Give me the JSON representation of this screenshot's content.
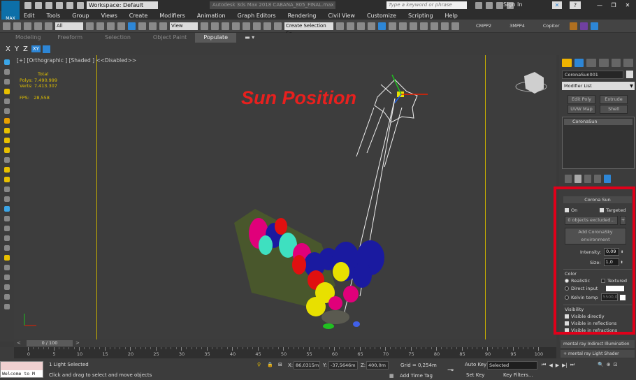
{
  "title_bar": {
    "app_badge": "MAX",
    "workspace": "Workspace: Default",
    "window_title": "Autodesk 3ds Max 2018    CABANA_805_FINAL.max",
    "search_placeholder": "Type a keyword or phrase",
    "sign_in": "Sign In"
  },
  "menu": [
    "Edit",
    "Tools",
    "Group",
    "Views",
    "Create",
    "Modifiers",
    "Animation",
    "Graph Editors",
    "Rendering",
    "Civil View",
    "Customize",
    "Scripting",
    "Help"
  ],
  "toolbar": {
    "filter_all": "All",
    "ref_coord": "View",
    "selection_set": "Create Selection Se",
    "extra": [
      "CMPP2",
      "3MPP4",
      "Copitor"
    ]
  },
  "ribbon_tabs": [
    "Modeling",
    "Freeform",
    "Selection",
    "Object Paint",
    "Populate"
  ],
  "ribbon_active": "Populate",
  "axes": [
    "X",
    "Y",
    "Z",
    "XY"
  ],
  "viewport": {
    "label": "[+] [Orthographic ] [Shaded ]  <<Disabled>>",
    "stats_total": "Total",
    "stats_polys_label": "Polys:",
    "stats_polys": "7.490.999",
    "stats_verts_label": "Verts:",
    "stats_verts": "7.413.307",
    "stats_fps_label": "FPS:",
    "stats_fps": "28,558",
    "annotation": "Sun Position"
  },
  "command_panel": {
    "object_name": "CoronaSun001",
    "modifier_list": "Modifier List",
    "buttons": [
      "Edit Poly",
      "Extrude",
      "UVW Map",
      "Shell"
    ],
    "stack_item": "CoronaSun",
    "rollout_title": "Corona Sun",
    "on_label": "On",
    "targeted_label": "Targeted",
    "excluded_button": "0 objects excluded...",
    "plus_button": "+",
    "add_sky_button": "Add CoronaSky environment",
    "intensity_label": "Intensity:",
    "intensity_value": "0,09",
    "size_label": "Size:",
    "size_value": "1,0",
    "color_label": "Color",
    "color_realistic": "Realistic",
    "color_textured": "Textured",
    "color_direct": "Direct input",
    "color_kelvin": "Kelvin temp",
    "kelvin_value": "5500,0",
    "visibility_label": "Visibility",
    "vis_directly": "Visible directly",
    "vis_reflections": "Visible in reflections",
    "vis_refractions": "Visible in refractions",
    "bottom_items": [
      "mental ray Indirect Illumination",
      "mental ray Light Shader"
    ]
  },
  "timeline": {
    "frame": "0 / 100",
    "ticks": [
      "0",
      "5",
      "10",
      "15",
      "20",
      "25",
      "30",
      "35",
      "40",
      "45",
      "50",
      "55",
      "60",
      "65",
      "70",
      "75",
      "80",
      "85",
      "90",
      "95",
      "100"
    ]
  },
  "status": {
    "maxscript": "Welcome to M",
    "selection": "1 Light Selected",
    "prompt": "Click and drag to select and move objects",
    "x_label": "X:",
    "x_value": "86,0315m",
    "y_label": "Y:",
    "y_value": "-37,5646m",
    "z_label": "Z:",
    "z_value": "400,0m",
    "grid": "Grid = 0,254m",
    "add_time_tag": "Add Time Tag",
    "auto_key": "Auto Key",
    "selected": "Selected",
    "set_key": "Set Key",
    "key_filters": "Key Filters..."
  }
}
